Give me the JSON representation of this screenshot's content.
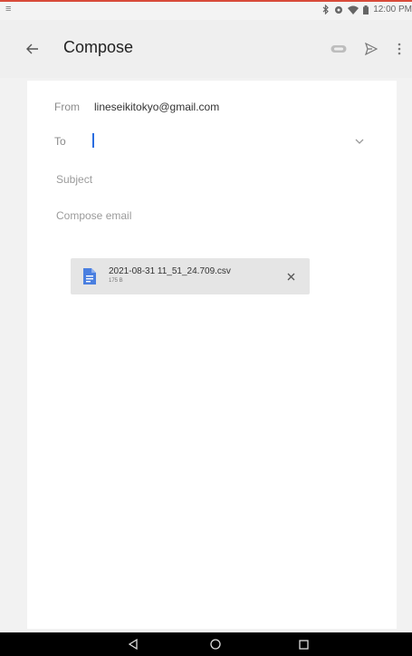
{
  "status_bar": {
    "left_glyph": "≡",
    "time": "12:00 PM",
    "icons": [
      "bluetooth-icon",
      "alarm-icon",
      "wifi-icon",
      "battery-icon"
    ]
  },
  "app_bar": {
    "title": "Compose",
    "back_icon": "arrow-back-icon",
    "actions": [
      "attachment-icon",
      "send-icon",
      "more-vert-icon"
    ]
  },
  "compose": {
    "from_label": "From",
    "from_value": "lineseikitokyo@gmail.com",
    "to_label": "To",
    "to_value": "",
    "subject_placeholder": "Subject",
    "body_placeholder": "Compose email"
  },
  "attachment": {
    "file_name": "2021-08-31 11_51_24.709.csv",
    "file_size": "175 B",
    "icon": "document-icon"
  },
  "nav_bar": {
    "buttons": [
      "back-triangle-icon",
      "home-circle-icon",
      "recents-square-icon"
    ]
  },
  "colors": {
    "accent": "#2a6de0",
    "status_accent": "#d84b3a",
    "doc_icon": "#4a7fe0"
  }
}
